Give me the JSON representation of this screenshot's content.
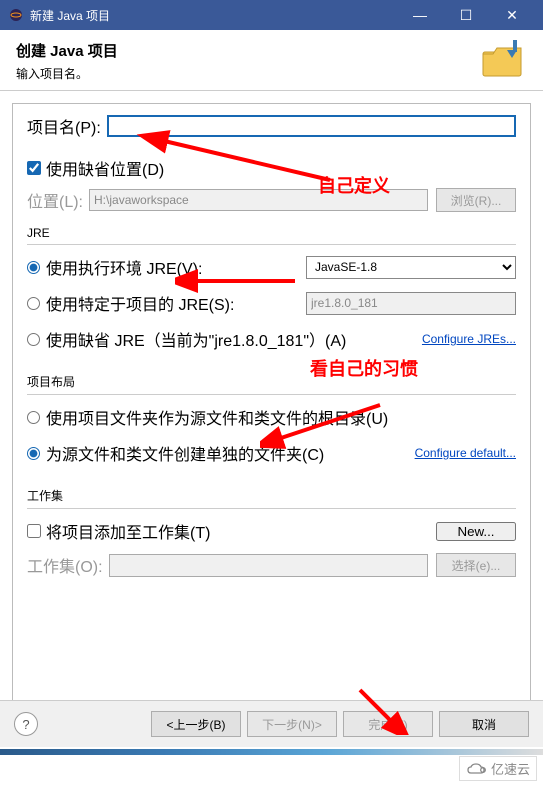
{
  "window": {
    "title": "新建 Java 项目"
  },
  "header": {
    "title": "创建 Java 项目",
    "subtitle": "输入项目名。"
  },
  "projectName": {
    "label": "项目名(P):",
    "value": ""
  },
  "useDefaultLoc": {
    "label": "使用缺省位置(D)"
  },
  "location": {
    "label": "位置(L):",
    "value": "H:\\javaworkspace",
    "browse": "浏览(R)..."
  },
  "jre": {
    "groupTitle": "JRE",
    "opt1": "使用执行环境 JRE(V):",
    "opt1Value": "JavaSE-1.8",
    "opt2": "使用特定于项目的 JRE(S):",
    "opt2Value": "jre1.8.0_181",
    "opt3": "使用缺省 JRE（当前为\"jre1.8.0_181\"）(A)",
    "configLink": "Configure JREs..."
  },
  "layout": {
    "groupTitle": "项目布局",
    "opt1": "使用项目文件夹作为源文件和类文件的根目录(U)",
    "opt2": "为源文件和类文件创建单独的文件夹(C)",
    "configLink": "Configure default..."
  },
  "workset": {
    "groupTitle": "工作集",
    "checkbox": "将项目添加至工作集(T)",
    "newBtn": "New...",
    "selectLabel": "工作集(O):",
    "selectBtn": "选择(e)..."
  },
  "footer": {
    "back": "<上一步(B)",
    "next": "下一步(N)>",
    "finish": "完成(F)",
    "cancel": "取消"
  },
  "annotations": {
    "a1": "自己定义",
    "a2": "看自己的习惯"
  },
  "watermark": "亿速云"
}
